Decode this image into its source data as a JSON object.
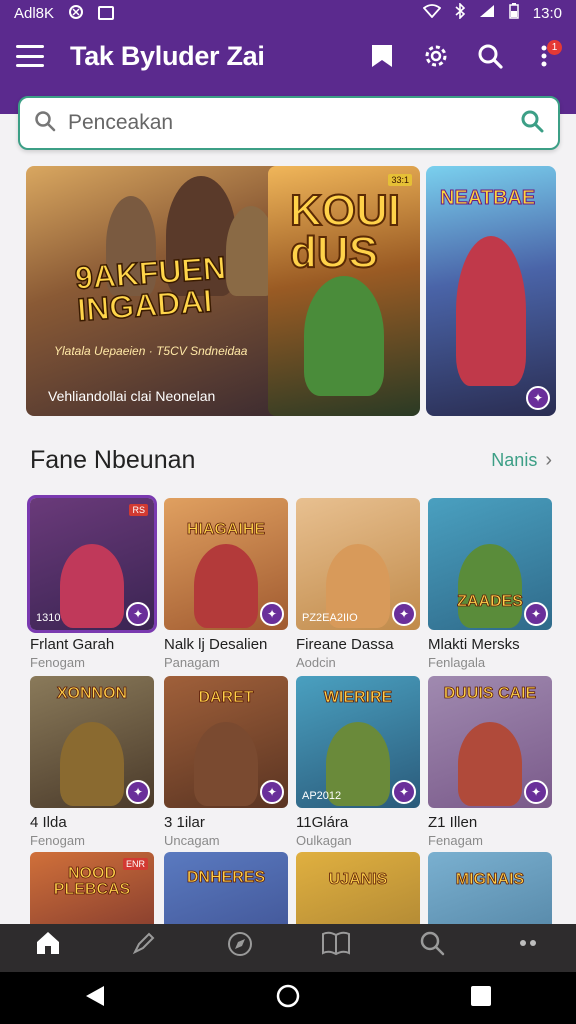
{
  "status_bar": {
    "left_label": "Adl8K",
    "time": "13:0"
  },
  "app_bar": {
    "title": "Tak Byluder Zai",
    "notification_count": "1"
  },
  "search": {
    "placeholder": "Penceakan"
  },
  "featured": [
    {
      "title": "9AKFUEN INGADAI",
      "subtitle": "Ylatala Uepaeien · T5CV Sndneidaa",
      "caption": "Vehliandollai clai Neonelan"
    },
    {
      "title": "KOUI dUS",
      "tag": "33:1"
    },
    {
      "title": "NEATBAE",
      "tag": ""
    }
  ],
  "section": {
    "title": "Fane Nbeunan",
    "link_label": "Nanis"
  },
  "games": [
    {
      "title": "",
      "name": "Frlant Garah",
      "sub": "Fenogam",
      "tag": "RS",
      "overlay": "1310",
      "bg": "#3a2452",
      "char": "#c0395a"
    },
    {
      "title": "HIAGAIHE",
      "name": "Nalk lj Desalien",
      "sub": "Panagam",
      "tag": "",
      "overlay": "",
      "bg": "#a05a30",
      "char": "#b33a3a"
    },
    {
      "title": "",
      "name": "Fireane Dassa",
      "sub": "Aodcin",
      "tag": "",
      "overlay": "PZ2EA2IIO",
      "bg": "#c08a4a",
      "char": "#d89a5a"
    },
    {
      "title": "ZAADES",
      "name": "Mlakti Mersks",
      "sub": "Fenlagala",
      "tag": "",
      "overlay": "",
      "bg": "#2f6a8a",
      "char": "#5a8c3a"
    },
    {
      "title": "XONNON",
      "name": "4 Ilda",
      "sub": "Fenogam",
      "tag": "",
      "overlay": "",
      "bg": "#4a3a2a",
      "char": "#8a6a30"
    },
    {
      "title": "DARET",
      "name": "3 1ilar",
      "sub": "Uncagam",
      "tag": "",
      "overlay": "",
      "bg": "#5a3422",
      "char": "#7a4a30"
    },
    {
      "title": "WIERIRE",
      "name": "11Glára",
      "sub": "Oulkagan",
      "tag": "",
      "overlay": "AP2012",
      "bg": "#2a5a7a",
      "char": "#6a8a3a"
    },
    {
      "title": "DUUIS CAIE",
      "name": "Z1 Illen",
      "sub": "Fenagam",
      "tag": "",
      "overlay": "",
      "bg": "#7a5a8a",
      "char": "#b04a3a"
    },
    {
      "title": "NOOD PLEBCAS",
      "name": "",
      "sub": "",
      "tag": "ENR",
      "overlay": "",
      "bg": "#6a2a2a",
      "char": "#d0603a"
    },
    {
      "title": "DNHERES",
      "name": "",
      "sub": "",
      "tag": "",
      "overlay": "",
      "bg": "#3a4a8a",
      "char": "#c04050"
    },
    {
      "title": "UJANIS",
      "name": "",
      "sub": "",
      "tag": "",
      "overlay": "",
      "bg": "#a07a30",
      "char": "#7a3a30"
    },
    {
      "title": "MIGNAIS",
      "name": "",
      "sub": "",
      "tag": "",
      "overlay": "",
      "bg": "#4a7a9a",
      "char": "#8a6a50"
    }
  ],
  "bottom_nav": [
    {
      "label": "",
      "icon": "home-icon"
    },
    {
      "label": "",
      "icon": "pen-icon"
    },
    {
      "label": "",
      "icon": "compass-icon"
    },
    {
      "label": "",
      "icon": "book-icon"
    },
    {
      "label": "",
      "icon": "search-icon"
    },
    {
      "label": "",
      "icon": "more-icon"
    }
  ],
  "colors": {
    "brand": "#5b2a8e",
    "accent": "#3c9f86",
    "nav_bg": "#2e2c2d"
  }
}
